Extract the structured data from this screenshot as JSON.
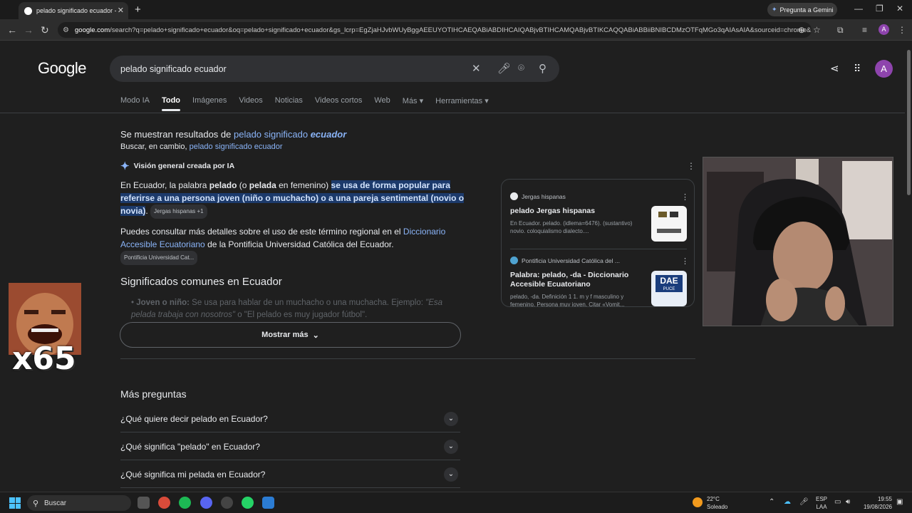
{
  "browser": {
    "tab_title": "pelado significado ecuador - B",
    "gemini_button": "Pregunta a Gemini",
    "url_host": "google.com",
    "url_rest": "/search?q=pelado+significado+ecuador&oq=pelado+significado+ecuador&gs_lcrp=EgZjaHJvbWUyBggAEEUYOTIHCAEQABiABDIHCAIQABjvBTIHCAMQABjvBTIKCAQQABiABBiiBNIBCDMzOTFqMGo3qAIAsAIA&sourceid=chrome&...",
    "profile_initial": "A"
  },
  "google": {
    "logo": "Google",
    "query": "pelado significado ecuador",
    "avatar_initial": "A",
    "tabs": [
      "Modo IA",
      "Todo",
      "Imágenes",
      "Videos",
      "Noticias",
      "Videos cortos",
      "Web",
      "Más ▾",
      "Herramientas ▾"
    ],
    "showing_prefix": "Se muestran resultados de",
    "showing_link": "pelado significado",
    "showing_bold": "ecuador",
    "instead_prefix": "Buscar, en cambio,",
    "instead_link": "pelado significado ecuador",
    "ai_title": "Visión general creada por IA",
    "para1_a": "En Ecuador, la palabra ",
    "para1_b": "pelado",
    "para1_c": " (o ",
    "para1_d": "pelada",
    "para1_e": " en femenino) ",
    "para1_hl": "se usa de forma popular para referirse a una persona joven (niño o muchacho) o a una pareja sentimental (novio o novia)",
    "para1_f": ". ",
    "chip1": "Jergas hispanas +1",
    "para2_a": "Puedes consultar más detalles sobre el uso de este término regional en el ",
    "para2_link": "Diccionario Accesible Ecuatoriano",
    "para2_b": " de la Pontificia Universidad Católica del Ecuador. ",
    "chip2": "Pontificia Universidad Cat...",
    "sig_title": "Significados comunes en Ecuador",
    "bullet_bold": "Joven o niño:",
    "bullet_text": " Se usa para hablar de un muchacho o una muchacha. Ejemplo: ",
    "bullet_ex": "\"Esa pelada trabaja con nosotros\"",
    "bullet_tail": " o \"El pelado es muy jugador fútbol\".",
    "more_button": "Mostrar más",
    "sources": [
      {
        "site": "Jergas hispanas",
        "title": "pelado Jergas hispanas",
        "snippet": "En Ecuador. pelado. (idlema=6476). (sustantivo) novio. coloquialismo dialecto...."
      },
      {
        "site": "Pontificia Universidad Católica del ...",
        "title": "Palabra: pelado, -da - Diccionario Accesible Ecuatoriano",
        "snippet": "pelado, -da. Definición 1 1. m y f masculino y femenino. Persona muy joven. Citar «Vomit..."
      }
    ],
    "dae_label": "DAE",
    "dae_sub": "PUCE",
    "more_questions": "Más preguntas",
    "questions": [
      "¿Qué quiere decir pelado en Ecuador?",
      "¿Qué significa \"pelado\" en Ecuador?",
      "¿Qué significa mi pelada en Ecuador?"
    ]
  },
  "overlay": {
    "meme_counter": "x65"
  },
  "taskbar": {
    "search": "Buscar",
    "temp": "22°C",
    "weather": "Soleado",
    "lang1": "ESP",
    "lang2": "LAA",
    "time": "19:55",
    "date": "19/08/2026"
  }
}
